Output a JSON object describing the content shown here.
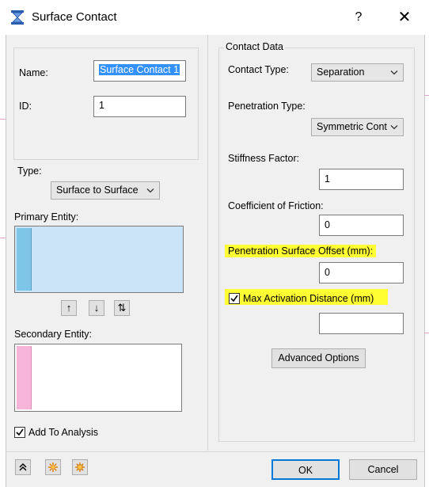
{
  "window": {
    "title": "Surface Contact",
    "help_label": "?",
    "close_label": "✕"
  },
  "left": {
    "name_label": "Name:",
    "name_value": "Surface Contact 1",
    "id_label": "ID:",
    "id_value": "1",
    "type_label": "Type:",
    "type_value": "Surface to Surface",
    "primary_label": "Primary Entity:",
    "move_up": "↑",
    "move_down": "↓",
    "swap": "⇅",
    "secondary_label": "Secondary Entity:",
    "add_to_analysis_label": "Add To Analysis",
    "add_to_analysis_checked": true,
    "primary_color": "#7ec6e8",
    "secondary_color": "#f5b4d8"
  },
  "contact_data": {
    "group_label": "Contact Data",
    "contact_type_label": "Contact Type:",
    "contact_type_value": "Separation",
    "penetration_type_label": "Penetration Type:",
    "penetration_type_value": "Symmetric Cont",
    "stiffness_label": "Stiffness Factor:",
    "stiffness_value": "1",
    "friction_label": "Coefficient of Friction:",
    "friction_value": "0",
    "offset_label": "Penetration Surface Offset (mm):",
    "offset_value": "0",
    "max_activation_label": "Max Activation Distance (mm)",
    "max_activation_checked": true,
    "max_activation_value": "",
    "advanced_label": "Advanced Options",
    "highlight_color": "#ffff33"
  },
  "footer": {
    "ok_label": "OK",
    "cancel_label": "Cancel",
    "tool_icons": [
      "collapse-icon",
      "starburst-icon",
      "starburst-grid-icon"
    ]
  }
}
